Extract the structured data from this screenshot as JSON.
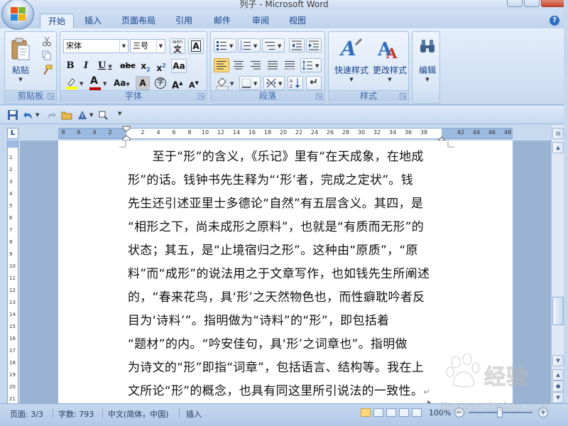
{
  "window": {
    "title": "列子 - Microsoft Word"
  },
  "tabs": [
    "开始",
    "插入",
    "页面布局",
    "引用",
    "邮件",
    "审阅",
    "视图"
  ],
  "ribbon": {
    "clipboard": {
      "label": "剪贴板",
      "paste": "粘贴"
    },
    "font": {
      "label": "字体",
      "font_name": "宋体",
      "font_size": "三号",
      "wen": "wén"
    },
    "paragraph": {
      "label": "段落"
    },
    "styles": {
      "label": "样式",
      "quick_styles": "快速样式",
      "change_styles": "更改样式"
    },
    "editing": {
      "label": "编辑"
    }
  },
  "ruler": {
    "corner": "L",
    "left_nums": [
      "8",
      "6",
      "4",
      "2"
    ],
    "nums": [
      "2",
      "4",
      "6",
      "8",
      "10",
      "12",
      "14",
      "16",
      "18",
      "20",
      "22",
      "24",
      "26",
      "28",
      "30",
      "32",
      "34",
      "36",
      "38"
    ],
    "right_nums": [
      "42",
      "44",
      "46",
      "48"
    ],
    "v_nums": [
      "1",
      "2",
      "3",
      "4",
      "5",
      "6",
      "7",
      "8",
      "9",
      "10",
      "11",
      "12",
      "13",
      "14",
      "15",
      "16",
      "17",
      "18",
      "19",
      "20",
      "21"
    ]
  },
  "document": {
    "lines": [
      "　　至于“形”的含义，《乐记》里有“在天成象，在地成",
      "形”的话。钱钟书先生释为“‘形’者，完成之定状”。钱",
      "先生还引述亚里士多德论“自然”有五层含义。其四，是",
      "“相形之下，尚未成形之原料”，也就是“有质而无形”的",
      "状态；其五，是“止境宿归之形”。这种由“原质”，“原",
      "料”而“成形”的说法用之于文章写作，也如钱先生所阐述",
      "的，“春来花鸟，具‘形’之天然物色也，而性癖耽吟者反",
      "目为‘诗料’”。指明做为“诗料”的“形”，即包括着",
      "“题材”的内。“吟安佳句，具‘形’之词章也”。指明做",
      "为诗文的“形”即指“词章”，包括语言、结构等。我在上",
      "文所论“形”的概念，也具有同这里所引说法的一致性。"
    ],
    "paragraph_mark": "↵"
  },
  "status": {
    "page": "页面: 3/3",
    "words": "字数: 793",
    "language": "中文(简体，中国)",
    "mode": "插入",
    "zoom": "100%"
  },
  "watermark": {
    "brand": "经验",
    "url": "jingyan.baidu.com"
  }
}
